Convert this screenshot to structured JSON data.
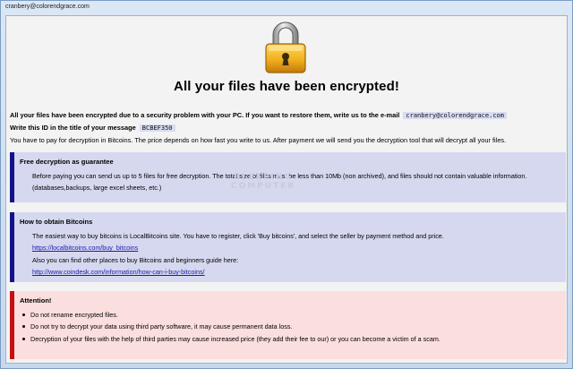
{
  "window": {
    "title": "cranbery@colorendgrace.com"
  },
  "lock_icon": "padlock-icon",
  "headline": "All your files have been encrypted!",
  "intro": {
    "line1_text": "All your files have been encrypted due to a security problem with your PC. If you want to restore them, write us to the e-mail",
    "email": "cranbery@colorendgrace.com",
    "line2_text": "Write this ID in the title of your message",
    "id": "BCBEF350",
    "line3_text": "You have to pay for decryption in Bitcoins. The price depends on how fast you write to us. After payment we will send you the decryption tool that will decrypt all your files."
  },
  "guarantee": {
    "title": "Free decryption as guarantee",
    "text": "Before paying you can send us up to 5 files for free decryption. The total size of files must be less than 10Mb (non archived), and files should not contain valuable information. (databases,backups, large excel sheets, etc.)"
  },
  "watermark": {
    "line1": "BLEEPING",
    "line2": "COMPUTER"
  },
  "bitcoins": {
    "title": "How to obtain Bitcoins",
    "text1": "The easiest way to buy bitcoins is LocalBitcoins site. You have to register, click 'Buy bitcoins', and select the seller by payment method and price.",
    "link1": "https://localbitcoins.com/buy_bitcoins",
    "text2": "Also you can find other places to buy Bitcoins and beginners guide here:",
    "link2": "http://www.coindesk.com/information/how-can-i-buy-bitcoins/"
  },
  "attention": {
    "title": "Attention!",
    "items": [
      "Do not rename encrypted files.",
      "Do not try to decrypt your data using third party software, it may cause permanent data loss.",
      "Decryption of your files with the help of third parties may cause increased price (they add their fee to our) or you can become a victim of a scam."
    ]
  },
  "colors": {
    "guarantee_accent": "#13138a",
    "attention_accent": "#c41010",
    "lock_gold": "#f2b01e"
  }
}
